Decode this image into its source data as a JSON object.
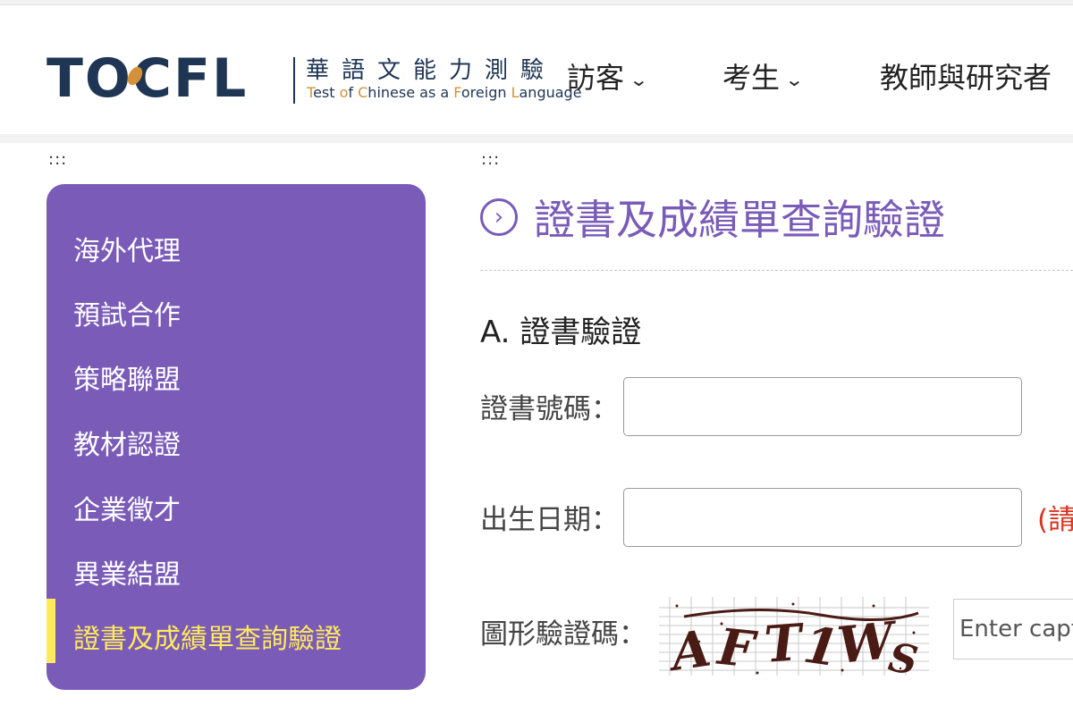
{
  "header": {
    "logo_mark": "TOCFL",
    "logo_zh": "華語文能力測驗",
    "logo_en_parts": [
      "T",
      "est ",
      "o",
      "f ",
      "C",
      "hinese as a ",
      "F",
      "oreign ",
      "L",
      "anguage"
    ],
    "brand_color": "#1f3554",
    "accent_color": "#d4913b"
  },
  "nav": {
    "items": [
      {
        "label": "訪客",
        "icon": "chevron-down-icon"
      },
      {
        "label": "考生",
        "icon": "chevron-down-icon"
      },
      {
        "label": "教師與研究者"
      }
    ]
  },
  "accesskeys": {
    "sidebar": ":::",
    "main": ":::"
  },
  "sidebar": {
    "bg_color": "#7a5cb8",
    "active_color": "#ffe95c",
    "items": [
      {
        "label": "海外代理"
      },
      {
        "label": "預試合作"
      },
      {
        "label": "策略聯盟"
      },
      {
        "label": "教材認證"
      },
      {
        "label": "企業徵才"
      },
      {
        "label": "異業結盟"
      },
      {
        "label": "證書及成績單查詢驗證",
        "active": true
      }
    ]
  },
  "main": {
    "title": "證書及成績單查詢驗證",
    "title_icon": "chevron-right-circle-icon",
    "section_a": "A. 證書驗證",
    "fields": {
      "cert_no_label": "證書號碼：",
      "birth_label": "出生日期：",
      "birth_hint": "(請",
      "captcha_label": "圖形驗證碼：",
      "captcha_text": "AFT1WS",
      "captcha_placeholder": "Enter captcha"
    }
  }
}
